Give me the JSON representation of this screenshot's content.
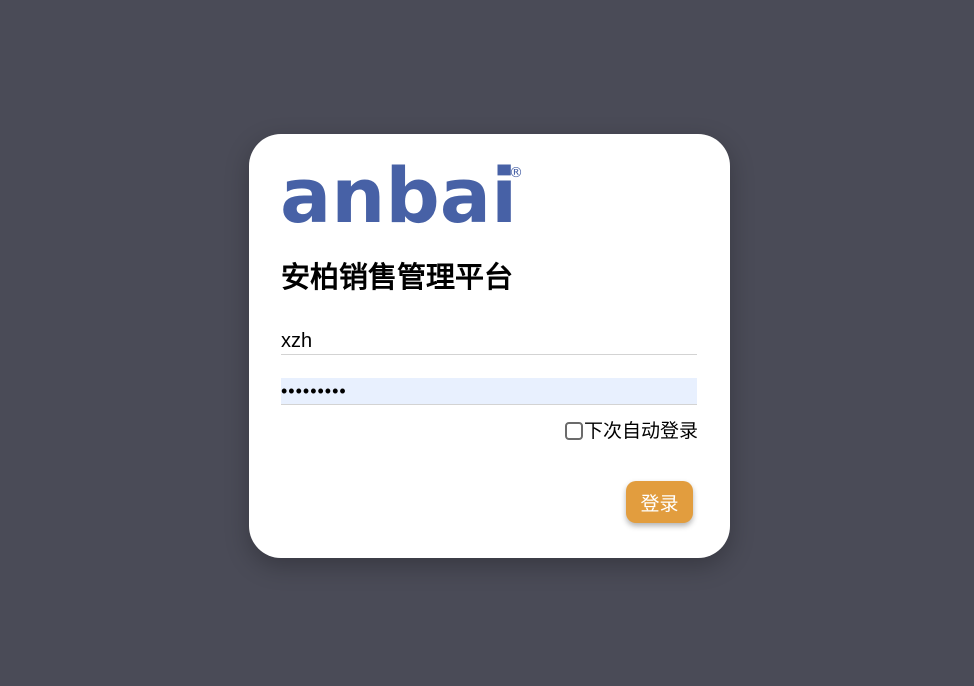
{
  "logo": {
    "text": "anbai",
    "registered_mark": "®",
    "color": "#4761a6"
  },
  "form": {
    "title": "安柏销售管理平台",
    "username": {
      "value": "xzh",
      "placeholder": ""
    },
    "password": {
      "value": "•••••••••",
      "placeholder": ""
    },
    "remember": {
      "label": "下次自动登录",
      "checked": false
    },
    "login_button_label": "登录",
    "login_button_color": "#e29d3e"
  },
  "colors": {
    "background": "#4a4b57",
    "card": "#ffffff"
  }
}
